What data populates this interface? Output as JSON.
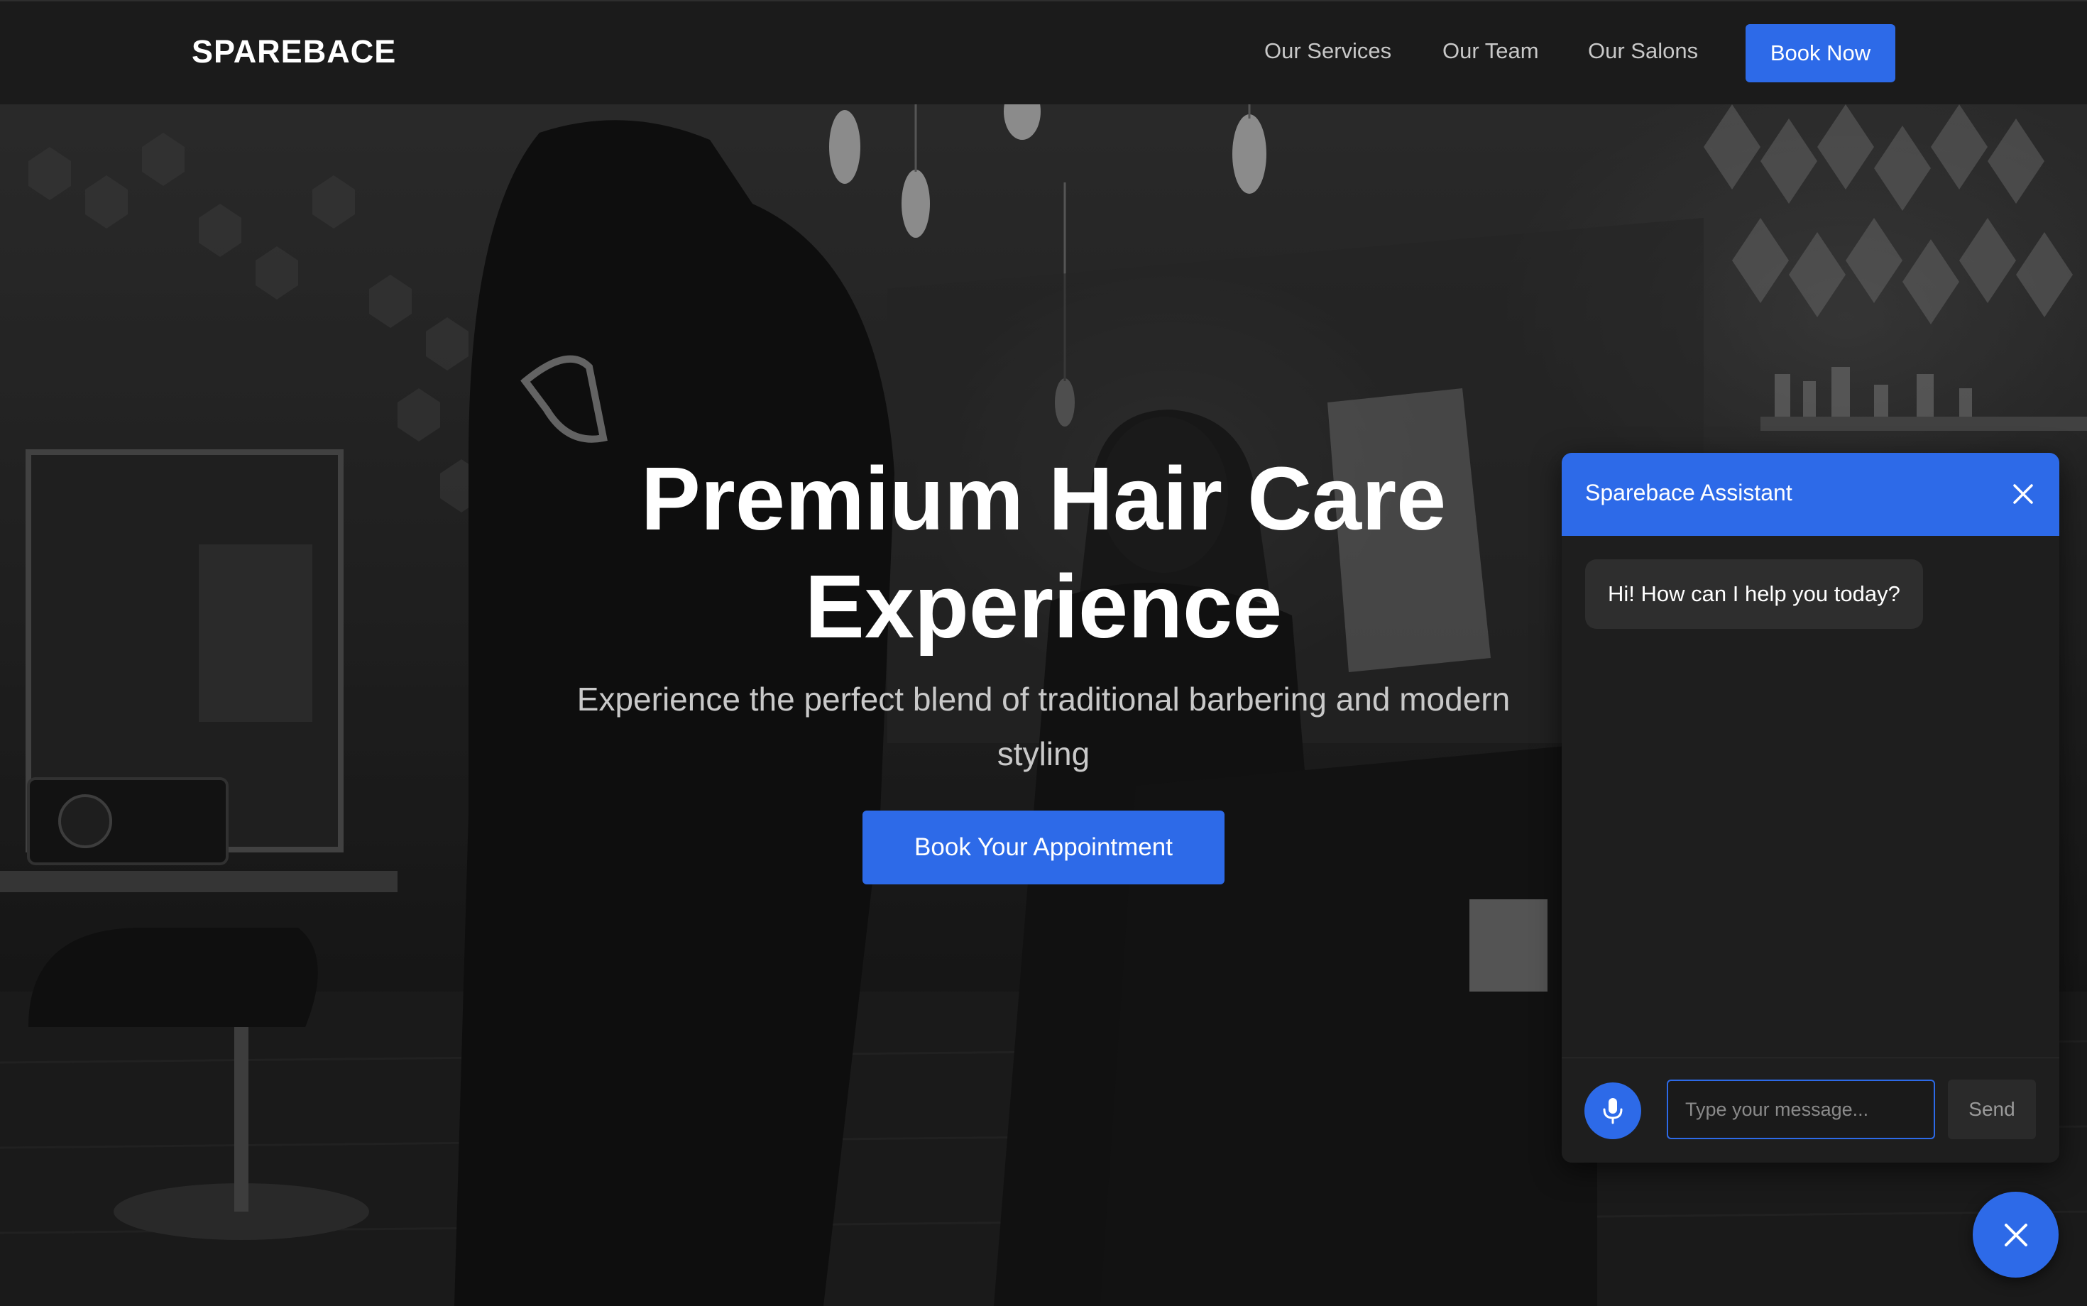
{
  "nav": {
    "brand": "SPAREBACE",
    "links": [
      "Our Services",
      "Our Team",
      "Our Salons"
    ],
    "book_now": "Book Now"
  },
  "hero": {
    "title": "Premium Hair Care Experience",
    "subtitle": "Experience the perfect blend of traditional barbering and modern styling",
    "cta": "Book Your Appointment"
  },
  "chat": {
    "title": "Sparebace Assistant",
    "messages": [
      "Hi! How can I help you today?"
    ],
    "input_placeholder": "Type your message...",
    "input_value": "",
    "send_label": "Send"
  },
  "icons": {
    "chat_close": "close-icon",
    "mic": "microphone-icon",
    "fab": "close-icon"
  },
  "colors": {
    "accent": "#2d6ae8",
    "nav_bg": "#1b1b1b",
    "panel_bg": "#1e1e1e"
  }
}
